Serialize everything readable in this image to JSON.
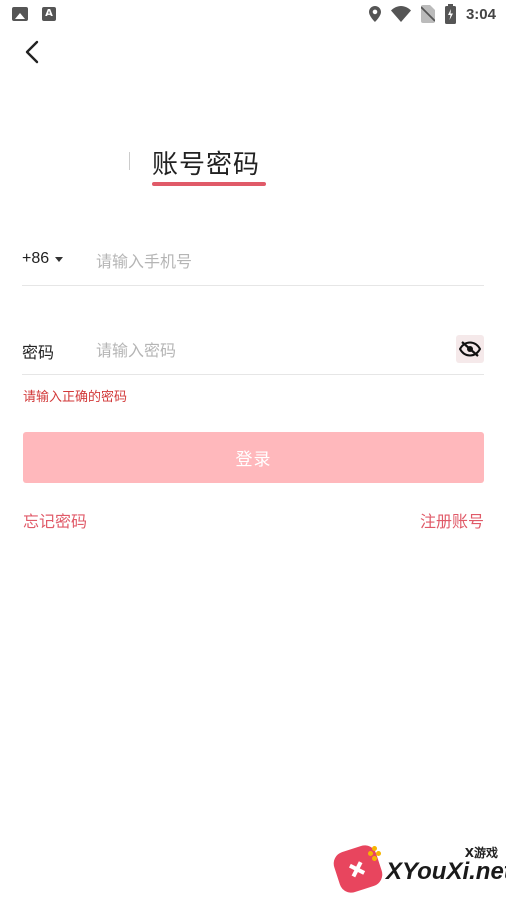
{
  "status_bar": {
    "notification_icons": [
      "image-icon",
      "a-icon"
    ],
    "system_icons": [
      "location-icon",
      "wifi-icon",
      "no-sim-icon",
      "battery-charging-icon"
    ],
    "time": "3:04"
  },
  "nav": {
    "back_icon": "back-arrow-icon"
  },
  "tab": {
    "title": "账号密码"
  },
  "phone": {
    "country_code": "+86",
    "placeholder": "请输入手机号",
    "value": ""
  },
  "password": {
    "label": "密码",
    "placeholder": "请输入密码",
    "value": "",
    "toggle_icon": "eye-off-icon"
  },
  "error": "请输入正确的密码",
  "login_label": "登录",
  "links": {
    "forgot": "忘记密码",
    "register": "注册账号"
  },
  "watermark": {
    "top_text": "X游戏",
    "text": "XYouXi.net"
  },
  "colors": {
    "accent": "#e05a68",
    "login_disabled": "#ffb8bc",
    "error": "#d23a3a",
    "placeholder": "#b5b5b5"
  }
}
